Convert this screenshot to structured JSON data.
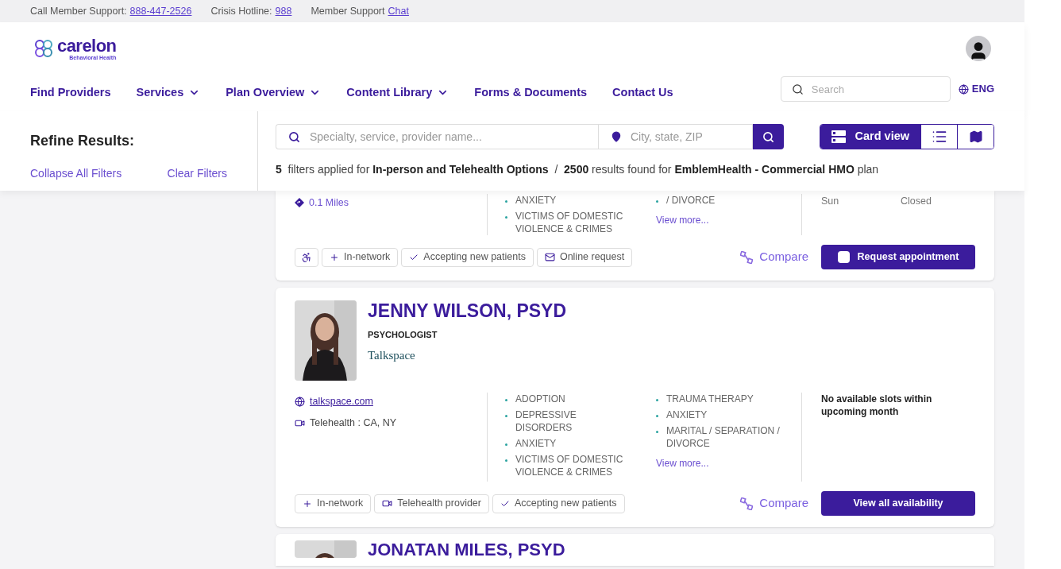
{
  "top_bar": {
    "items": [
      {
        "label": "Call Member Support:",
        "link": "888-447-2526"
      },
      {
        "label": "Crisis Hotline:",
        "link": "988"
      },
      {
        "label": "Member Support",
        "link": "Chat"
      }
    ]
  },
  "header": {
    "logo": {
      "name": "carelon",
      "tagline": "Behavioral Health"
    },
    "nav": [
      {
        "label": "Find Providers",
        "has_menu": false
      },
      {
        "label": "Services",
        "has_menu": true
      },
      {
        "label": "Plan Overview",
        "has_menu": true
      },
      {
        "label": "Content Library",
        "has_menu": true
      },
      {
        "label": "Forms & Documents",
        "has_menu": false
      },
      {
        "label": "Contact Us",
        "has_menu": false
      }
    ],
    "search": {
      "placeholder": "Search"
    },
    "language": "ENG"
  },
  "filters": {
    "title": "Refine Results:",
    "actions": [
      "Collapse All Filters",
      "Clear Filters"
    ],
    "search": {
      "placeholder": "Specialty, service, provider name..."
    },
    "location": {
      "placeholder": "City, state, ZIP"
    },
    "views": [
      {
        "kind": "card",
        "label": "Card view",
        "selected": true
      },
      {
        "kind": "list",
        "selected": false
      },
      {
        "kind": "map",
        "selected": false
      }
    ],
    "summary": "**5**  filters applied for **In-person and Telehealth Options**  /  **2500** results found for **EmblemHealth - Commercial HMO** plan"
  },
  "providers": [
    {
      "cut_top": true,
      "contacts": [
        {
          "kind": "distance",
          "text": "0.1 Miles"
        }
      ],
      "specialties": [
        [
          "ANXIETY",
          "VICTIMS OF DOMESTIC VIOLENCE & CRIMES"
        ],
        [
          "/ DIVORCE"
        ]
      ],
      "more": "View more...",
      "hours": [
        {
          "day": "Sun",
          "time": "Closed"
        }
      ],
      "badges": [
        {
          "kind": "accessible"
        },
        {
          "kind": "network",
          "label": "In-network"
        },
        {
          "kind": "accepting",
          "label": "Accepting new patients"
        },
        {
          "kind": "online",
          "label": "Online request"
        }
      ],
      "compare": "Compare",
      "action": {
        "kind": "request",
        "label": "Request appointment"
      }
    },
    {
      "cut_top": false,
      "name": "JENNY WILSON, PSYD",
      "title": "PSYCHOLOGIST",
      "organization": "Talkspace",
      "contacts": [
        {
          "kind": "web",
          "text": "talkspace.com"
        },
        {
          "kind": "telehealth",
          "text": "Telehealth : CA, NY"
        }
      ],
      "specialties": [
        [
          "ADOPTION",
          "DEPRESSIVE DISORDERS",
          "ANXIETY",
          "VICTIMS OF DOMESTIC VIOLENCE & CRIMES"
        ],
        [
          "TRAUMA THERAPY",
          "ANXIETY",
          "MARITAL / SEPARATION / DIVORCE"
        ]
      ],
      "more": "View more...",
      "availability": "No available slots within upcoming month",
      "badges": [
        {
          "kind": "network",
          "label": "In-network"
        },
        {
          "kind": "telehealth",
          "label": "Telehealth provider"
        },
        {
          "kind": "accepting",
          "label": "Accepting new patients"
        }
      ],
      "compare": "Compare",
      "action": {
        "kind": "view",
        "label": "View all availability"
      }
    },
    {
      "cut_top": false,
      "cut_bottom": true,
      "name": "JONATAN MILES, PSYD"
    }
  ]
}
